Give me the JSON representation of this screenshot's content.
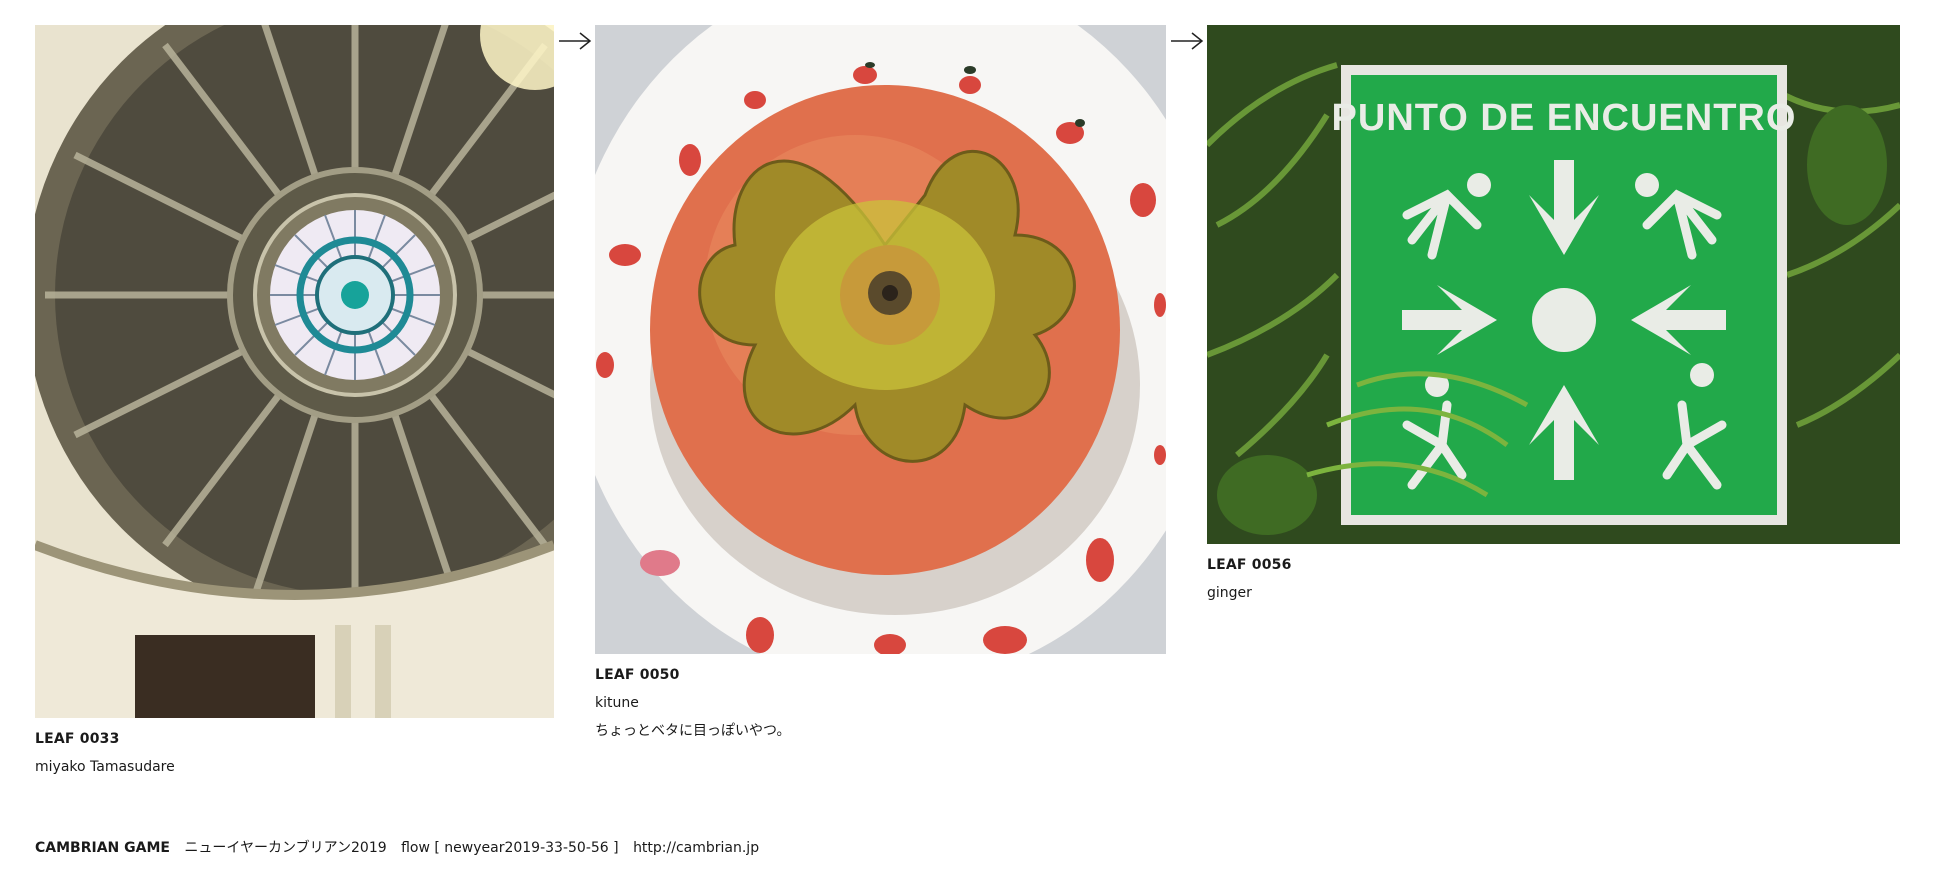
{
  "flow": {
    "leaves": [
      {
        "id_label": "LEAF 0033",
        "author": "miyako Tamasudare",
        "comment": "",
        "image_icon": "dome-ceiling-photo"
      },
      {
        "id_label": "LEAF 0050",
        "author": "kitune",
        "comment": "ちょっとベタに目っぽいやつ。",
        "image_icon": "persimmon-plate-photo"
      },
      {
        "id_label": "LEAF 0056",
        "author": "ginger",
        "comment": "",
        "image_icon": "assembly-point-sign-photo"
      }
    ],
    "arrow_icon": "right-arrow-icon"
  },
  "sign": {
    "text": "PUNTO DE ENCUENTRO"
  },
  "footer": {
    "game": "CAMBRIAN GAME",
    "title": "ニューイヤーカンブリアン2019",
    "flow": "flow [ newyear2019-33-50-56 ]",
    "url": "http://cambrian.jp"
  },
  "colors": {
    "sign_green": "#22a94a",
    "persimmon": "#e0704d",
    "dome_stone": "#5a5544"
  }
}
